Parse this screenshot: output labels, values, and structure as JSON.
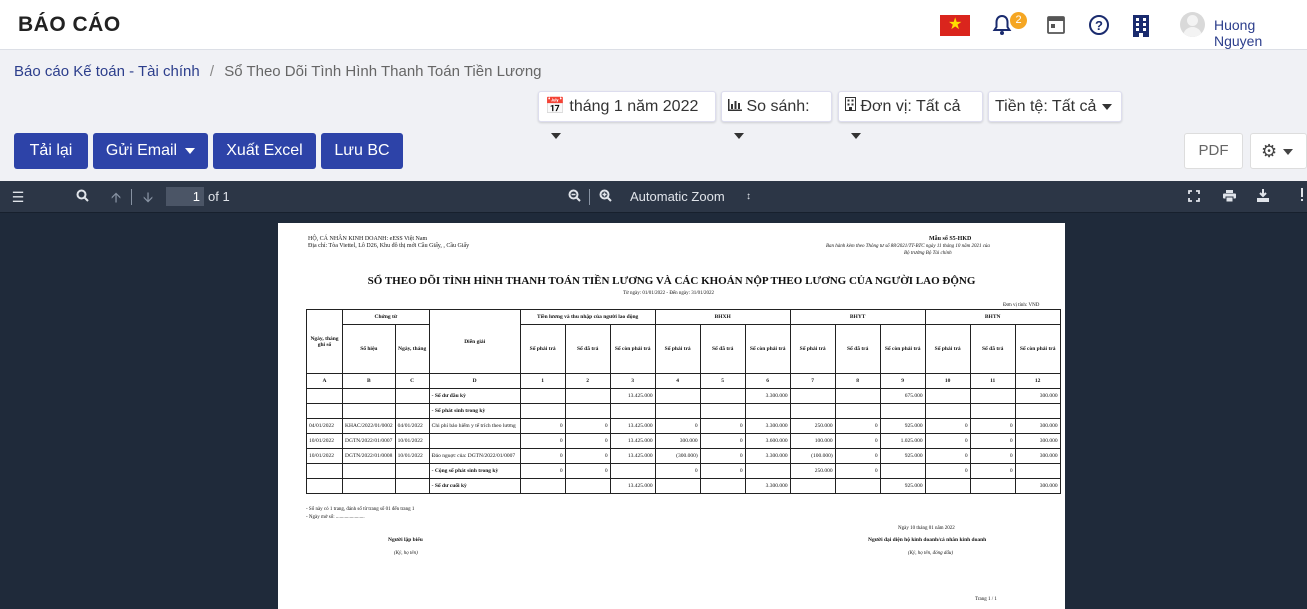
{
  "header": {
    "title": "BÁO CÁO",
    "notification_count": "2",
    "user_name": "Huong Nguyen",
    "icons": [
      "vietnam-flag-icon",
      "bell-icon",
      "calendar-icon",
      "help-icon",
      "building-icon",
      "user-avatar-icon"
    ]
  },
  "breadcrumb": {
    "parent": "Báo cáo Kế toán - Tài chính",
    "separator": "/",
    "current": "Sổ Theo Dõi Tình Hình Thanh Toán Tiền Lương"
  },
  "filters": {
    "period": "tháng 1 năm 2022",
    "compare": "So sánh:",
    "unit": "Đơn vị: Tất cả",
    "currency": "Tiền tệ: Tất cả"
  },
  "actions": {
    "reload": "Tải lại",
    "send_email": "Gửi Email",
    "export_excel": "Xuất Excel",
    "save": "Lưu BC",
    "pdf": "PDF"
  },
  "viewer": {
    "page_number": "1",
    "page_total": "of 1",
    "zoom": "Automatic Zoom"
  },
  "colors": {
    "primary": "#2d43a8",
    "brand_text": "#2c3e8c",
    "viewer_bg": "#1f2a3a",
    "badge": "#f5a623"
  },
  "report": {
    "org_line1": "HỘ, CÁ NHÂN KINH DOANH: eESS Việt Nam",
    "org_line2": "Địa chỉ: Tòa Viettel, Lô D26, Khu đô thị mới Cầu Giấy, , Cầu Giấy",
    "form_no": "Mẫu số S5-HKD",
    "form_note1": "Ban hành kèm theo Thông tư số 88/2021/TT-BTC ngày 11 tháng 10 năm 2021 của",
    "form_note2": "Bộ trưởng Bộ Tài chính",
    "title": "SỔ THEO DÕI TÌNH HÌNH THANH TOÁN TIỀN LƯƠNG VÀ CÁC KHOẢN NỘP THEO LƯƠNG CỦA NGƯỜI LAO ĐỘNG",
    "date_range": "Từ ngày: 01/01/2022 - Đến ngày: 31/01/2022",
    "currency_unit": "Đơn vị tính: VND",
    "headers": {
      "date": "Ngày, tháng ghi sổ",
      "voucher": "Chứng từ",
      "voucher_no": "Số hiệu",
      "voucher_date": "Ngày, tháng",
      "description": "Diễn giải",
      "group_salary": "Tiền lương và thu nhập của người lao động",
      "group_bhxh": "BHXH",
      "group_bhyt": "BHYT",
      "group_bhtn": "BHTN",
      "payable": "Số phải trả",
      "paid": "Số đã trả",
      "remaining": "Số còn phải trả"
    },
    "codes": [
      "A",
      "B",
      "C",
      "D",
      "1",
      "2",
      "3",
      "4",
      "5",
      "6",
      "7",
      "8",
      "9",
      "10",
      "11",
      "12"
    ],
    "rows": [
      [
        "",
        "",
        "",
        "- Số dư đầu kỳ",
        "",
        "",
        "13.425.000",
        "",
        "",
        "3.300.000",
        "",
        "",
        "675.000",
        "",
        "",
        "300.000"
      ],
      [
        "",
        "",
        "",
        "- Số phát sinh trong kỳ",
        "",
        "",
        "",
        "",
        "",
        "",
        "",
        "",
        "",
        "",
        "",
        ""
      ],
      [
        "04/01/2022",
        "KHAC/2022/01/0002",
        "04/01/2022",
        "Chi phí bảo hiểm y tế trích theo lương",
        "0",
        "0",
        "13.425.000",
        "0",
        "0",
        "3.300.000",
        "250.000",
        "0",
        "925.000",
        "0",
        "0",
        "300.000"
      ],
      [
        "10/01/2022",
        "DGTN/2022/01/0007",
        "10/01/2022",
        "",
        "0",
        "0",
        "13.425.000",
        "300.000",
        "0",
        "3.600.000",
        "100.000",
        "0",
        "1.025.000",
        "0",
        "0",
        "300.000"
      ],
      [
        "10/01/2022",
        "DGTN/2022/01/0008",
        "10/01/2022",
        "Đảo nguợc của: DGTN/2022/01/0007",
        "0",
        "0",
        "13.425.000",
        "(300.000)",
        "0",
        "3.300.000",
        "(100.000)",
        "0",
        "925.000",
        "0",
        "0",
        "300.000"
      ],
      [
        "",
        "",
        "",
        "- Cộng số phát sinh trong kỳ",
        "0",
        "0",
        "",
        "0",
        "0",
        "",
        "250.000",
        "0",
        "",
        "0",
        "0",
        ""
      ],
      [
        "",
        "",
        "",
        "- Số dư cuối kỳ",
        "",
        "",
        "13.425.000",
        "",
        "",
        "3.300.000",
        "",
        "",
        "925.000",
        "",
        "",
        "300.000"
      ]
    ],
    "note1": "- Sổ này có 1 trang, đánh số từ trang số 01 đến trang 1",
    "note2": "- Ngày mở sổ: .......................",
    "sign_date": "Ngày 10 tháng 01 năm 2022",
    "preparer": "Người lập biểu",
    "preparer_sub": "(Ký, họ tên)",
    "representative": "Người đại diện hộ kinh doanh/cá nhân kinh doanh",
    "representative_sub": "(Ký, họ tên, đóng dấu)",
    "page_footer": "Trang 1 /   1"
  }
}
